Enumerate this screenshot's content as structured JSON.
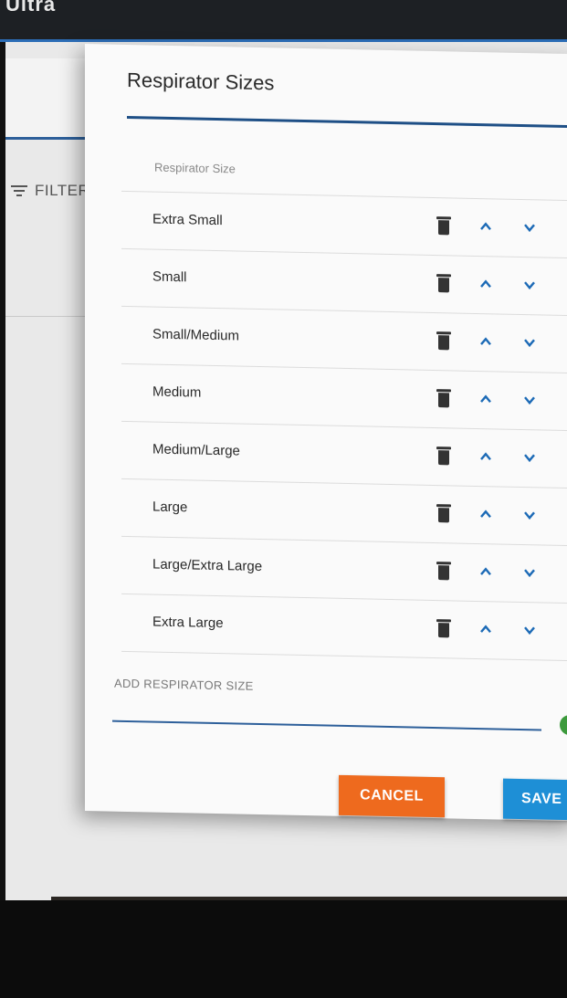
{
  "app": {
    "title": "Ultra"
  },
  "background": {
    "filter_label": "FILTER"
  },
  "dialog": {
    "title": "Respirator Sizes",
    "column_header": "Respirator Size",
    "sizes": [
      "Extra Small",
      "Small",
      "Small/Medium",
      "Medium",
      "Medium/Large",
      "Large",
      "Large/Extra Large",
      "Extra Large"
    ],
    "add_label": "ADD RESPIRATOR SIZE",
    "add_value": "",
    "cancel_label": "CANCEL",
    "save_label": "SAVE"
  },
  "icons": {
    "delete": "trash-icon",
    "move_up": "chevron-up-icon",
    "move_down": "chevron-down-icon",
    "confirm": "check-circle-icon"
  },
  "colors": {
    "accent_blue": "#1c6ab6",
    "cancel_orange": "#ee6a1e",
    "save_blue": "#1e8fd6",
    "confirm_green": "#3c9a3c"
  }
}
